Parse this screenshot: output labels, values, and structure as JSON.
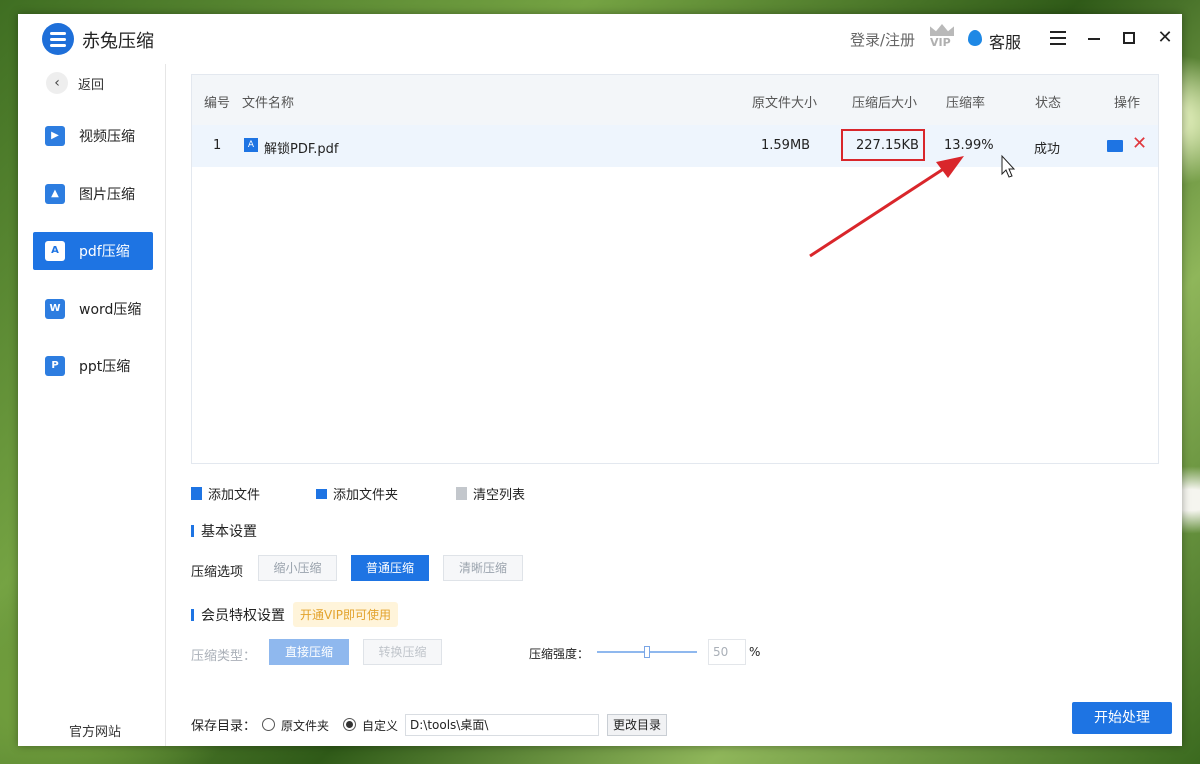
{
  "app": {
    "title": "赤兔压缩",
    "login": "登录/注册",
    "vip": "VIP",
    "service": "客服"
  },
  "sidebar": {
    "back": "返回",
    "items": [
      {
        "label": "视频压缩",
        "icon": "video-icon",
        "active": false
      },
      {
        "label": "图片压缩",
        "icon": "image-icon",
        "active": false
      },
      {
        "label": "pdf压缩",
        "icon": "pdf-icon",
        "active": true
      },
      {
        "label": "word压缩",
        "icon": "word-icon",
        "active": false
      },
      {
        "label": "ppt压缩",
        "icon": "ppt-icon",
        "active": false
      }
    ],
    "official_site": "官方网站"
  },
  "table": {
    "headers": [
      "编号",
      "文件名称",
      "原文件大小",
      "压缩后大小",
      "压缩率",
      "状态",
      "操作"
    ],
    "rows": [
      {
        "index": "1",
        "name": "解锁PDF.pdf",
        "original_size": "1.59MB",
        "compressed_size": "227.15KB",
        "ratio": "13.99%",
        "status": "成功"
      }
    ]
  },
  "actions": {
    "add_file": "添加文件",
    "add_folder": "添加文件夹",
    "clear_list": "清空列表"
  },
  "basic": {
    "title": "基本设置",
    "option_label": "压缩选项",
    "options": [
      "缩小压缩",
      "普通压缩",
      "清晰压缩"
    ],
    "selected": "普通压缩"
  },
  "vip_settings": {
    "title": "会员特权设置",
    "tag": "开通VIP即可使用",
    "type_label": "压缩类型：",
    "types": [
      "直接压缩",
      "转换压缩"
    ],
    "strength_label": "压缩强度：",
    "strength_value": "50",
    "strength_unit": "%"
  },
  "save": {
    "label": "保存目录：",
    "option_original": "原文件夹",
    "option_custom": "自定义",
    "path": "D:\\tools\\桌面\\",
    "change": "更改目录",
    "start": "开始处理"
  },
  "colors": {
    "accent": "#1e74e3",
    "highlight": "#d9262b"
  }
}
